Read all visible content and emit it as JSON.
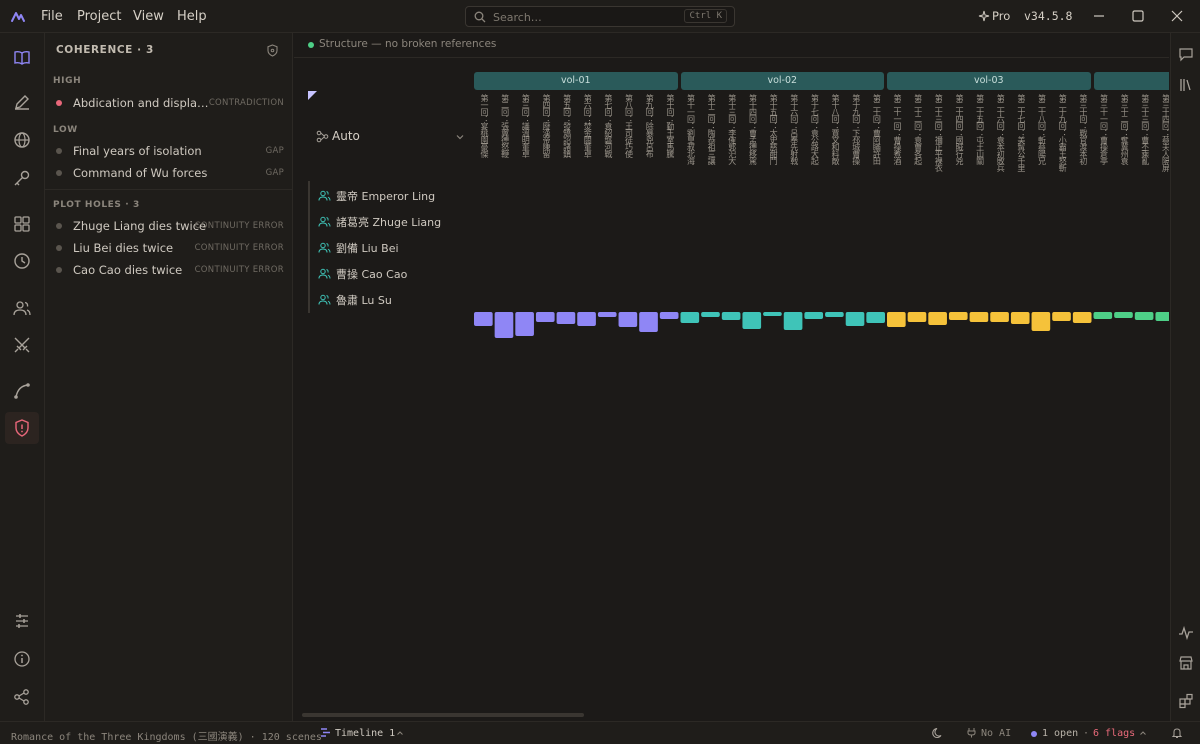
{
  "menu": {
    "file": "File",
    "project": "Project",
    "view": "View",
    "help": "Help"
  },
  "search": {
    "placeholder": "Search…",
    "shortcut": "Ctrl K"
  },
  "plan": {
    "label": "Pro"
  },
  "version": "v34.5.8",
  "coherence": {
    "title": "COHERENCE · 3",
    "sections": [
      {
        "label": "HIGH",
        "items": [
          {
            "text": "Abdication and displace…",
            "tag": "CONTRADICTION",
            "severity_color": "#e8677a"
          }
        ]
      },
      {
        "label": "LOW",
        "items": [
          {
            "text": "Final years of isolation",
            "tag": "GAP",
            "severity_color": "#5a554e"
          },
          {
            "text": "Command of Wu forces",
            "tag": "GAP",
            "severity_color": "#5a554e"
          }
        ]
      },
      {
        "label": "PLOT HOLES · 3",
        "items": [
          {
            "text": "Zhuge Liang dies twice",
            "tag": "CONTINUITY ERROR",
            "severity_color": "#5a554e"
          },
          {
            "text": "Liu Bei dies twice",
            "tag": "CONTINUITY ERROR",
            "severity_color": "#5a554e"
          },
          {
            "text": "Cao Cao dies twice",
            "tag": "CONTINUITY ERROR",
            "severity_color": "#5a554e"
          }
        ]
      }
    ]
  },
  "structure_status": "Structure — no broken references",
  "grouping": {
    "label": "Auto"
  },
  "characters": [
    "靈帝 Emperor Ling",
    "諸葛亮 Zhuge Liang",
    "劉備 Liu Bei",
    "曹操 Cao Cao",
    "魯肅 Lu Su"
  ],
  "volumes": [
    {
      "label": "vol-01",
      "color": "#2a5a5a"
    },
    {
      "label": "vol-02",
      "color": "#2a5a5a"
    },
    {
      "label": "vol-03",
      "color": "#2a5a5a"
    },
    {
      "label": "",
      "color": "#2a5a5a"
    }
  ],
  "scenes": [
    "第一回：宴桃園豪傑",
    "第二回：張翼德怒鞭",
    "第三回：議溫明董卓",
    "第四回：廢漢帝陳留",
    "第五回：發矯詔諸鎮",
    "第六回：焚金闕董卓",
    "第七回：袁紹磐河戰",
    "第八回：王司徒巧使",
    "第九回：除暴兇呂布",
    "第十回：勤王室馬騰",
    "第十一回：劉皇叔北海",
    "第十二回：陶恭祖三讓",
    "第十三回：李傕郭汜大",
    "第十四回：曹孟德移駕",
    "第十五回：太史慈酣鬥",
    "第十六回：呂奉先射戟",
    "第十七回：袁公路大起",
    "第十八回：賈文和料敵",
    "第十九回：下邳城曹操",
    "第二十回：曹阿瞞許田",
    "第二十一回：曹操煮酒",
    "第二十二回：袁曹各起",
    "第二十三回：禰正平裸衣",
    "第二十四回：國賊行兇",
    "第二十五回：屯土山關",
    "第二十六回：袁本初敗兵",
    "第二十七回：美髯公千里",
    "第二十八回：斬蔡陽兄",
    "第二十九回：小霸王怒斬",
    "第三十回：戰官渡本初",
    "第三十一回：曹操倉亭",
    "第三十二回：奪冀州袁",
    "第三十三回：曹丕乘亂",
    "第三十四回：蔡夫人隔屏"
  ],
  "chart_data": {
    "type": "bar",
    "title": "",
    "series": [
      {
        "name": "",
        "color": "#8f86f5",
        "values": [
          -14,
          -26,
          -24,
          -10,
          -12,
          -14,
          -5,
          -15,
          -20,
          -7
        ]
      },
      {
        "name": "",
        "color": "#3fc4b8",
        "values": [
          -11,
          -5,
          -8,
          -17,
          -4,
          -18,
          -7,
          -5,
          -14,
          -11
        ]
      },
      {
        "name": "",
        "color": "#f5c23a",
        "values": [
          -15,
          -10,
          -13,
          -8,
          -10,
          -10,
          -12,
          -19,
          -9,
          -11
        ]
      },
      {
        "name": "",
        "color": "#4ecf87",
        "values": [
          -7,
          -6,
          -8,
          -9
        ]
      }
    ]
  },
  "status_bar": {
    "project": "Romance of the Three Kingdoms (三國演義) · 120 scenes",
    "timeline": "Timeline 1",
    "ai": "No AI",
    "open": "1 open",
    "sep": "·",
    "flags": "6 flags"
  }
}
